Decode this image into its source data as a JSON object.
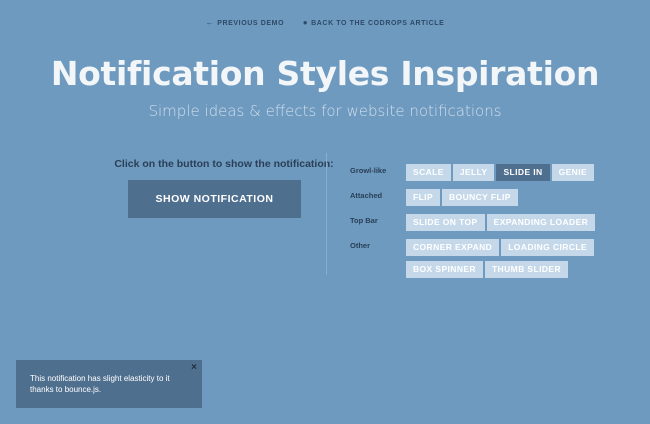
{
  "topnav": {
    "previous_label": "PREVIOUS DEMO",
    "back_label": "BACK TO THE CODROPS ARTICLE"
  },
  "header": {
    "title": "Notification Styles Inspiration",
    "subtitle": "Simple ideas & effects for website notifications"
  },
  "main": {
    "prompt": "Click on the button to show the notification:",
    "show_button": "SHOW NOTIFICATION"
  },
  "groups": [
    {
      "label": "Growl-like",
      "rows": [
        [
          "SCALE",
          "JELLY",
          "SLIDE IN",
          "GENIE"
        ]
      ]
    },
    {
      "label": "Attached",
      "rows": [
        [
          "FLIP",
          "BOUNCY FLIP"
        ]
      ]
    },
    {
      "label": "Top Bar",
      "rows": [
        [
          "SLIDE ON TOP",
          "EXPANDING LOADER"
        ]
      ]
    },
    {
      "label": "Other",
      "rows": [
        [
          "CORNER EXPAND",
          "LOADING CIRCLE"
        ],
        [
          "BOX SPINNER",
          "THUMB SLIDER"
        ]
      ]
    }
  ],
  "active_style": "SLIDE IN",
  "notification": {
    "text": "This notification has slight elasticity to it thanks to bounce.js.",
    "close_icon": "×"
  },
  "colors": {
    "background": "#6e9ac0",
    "button_dark": "#4f6f8f",
    "button_light": "#c4d8ea"
  }
}
